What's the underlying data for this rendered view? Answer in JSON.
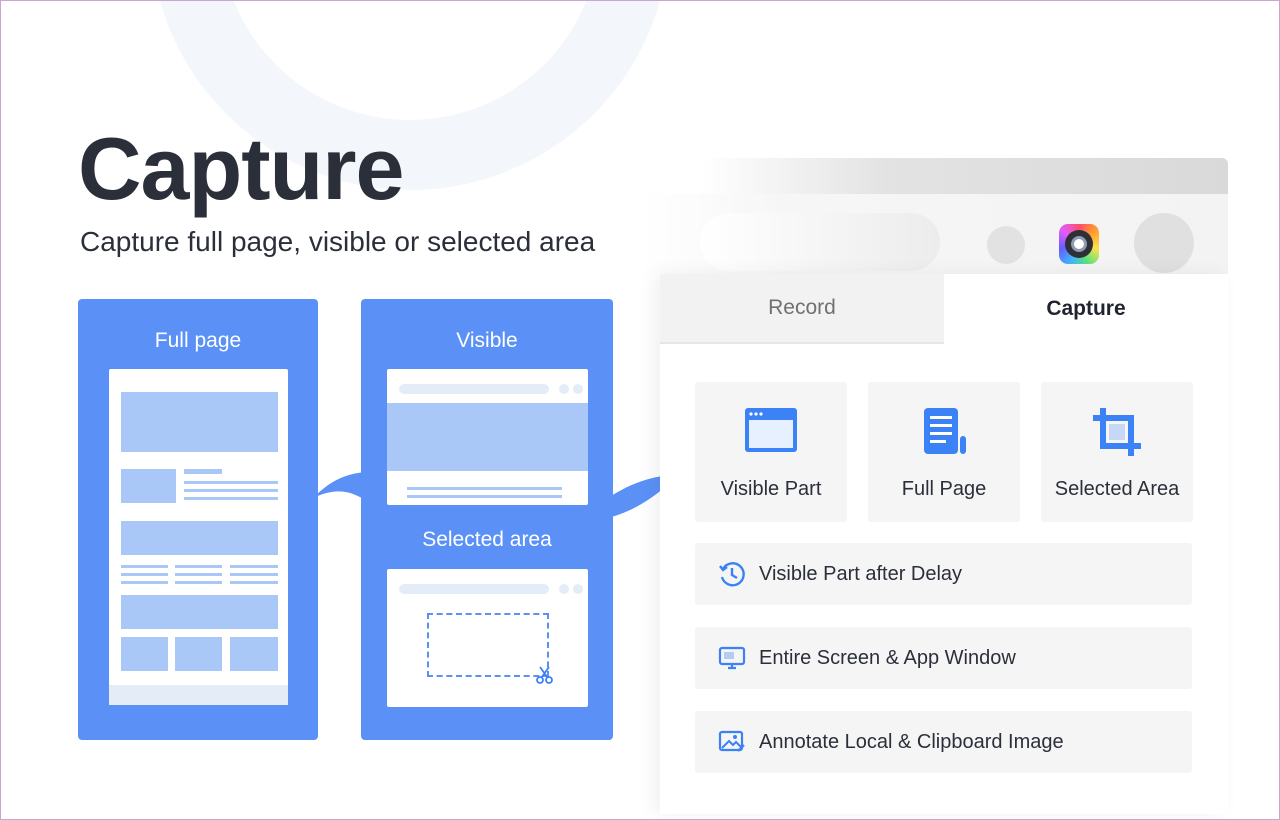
{
  "hero": {
    "title": "Capture",
    "subtitle": "Capture full page, visible or selected area"
  },
  "cards": {
    "full_page": "Full page",
    "visible": "Visible",
    "selected_area": "Selected area"
  },
  "popup": {
    "tabs": [
      {
        "label": "Record",
        "active": false
      },
      {
        "label": "Capture",
        "active": true
      }
    ],
    "tiles": [
      {
        "label": "Visible Part",
        "icon": "browser-window-icon"
      },
      {
        "label": "Full Page",
        "icon": "scroll-page-icon"
      },
      {
        "label": "Selected Area",
        "icon": "crop-icon"
      }
    ],
    "rows": [
      {
        "label": "Visible Part after Delay",
        "icon": "timer-icon"
      },
      {
        "label": "Entire Screen & App Window",
        "icon": "monitor-icon"
      },
      {
        "label": "Annotate Local & Clipboard Image",
        "icon": "image-edit-icon"
      }
    ]
  },
  "colors": {
    "card_blue": "#5b91f7",
    "mock_blue": "#a9c8f8",
    "icon_blue": "#3b82f6",
    "text_dark": "#2b2f3a"
  }
}
